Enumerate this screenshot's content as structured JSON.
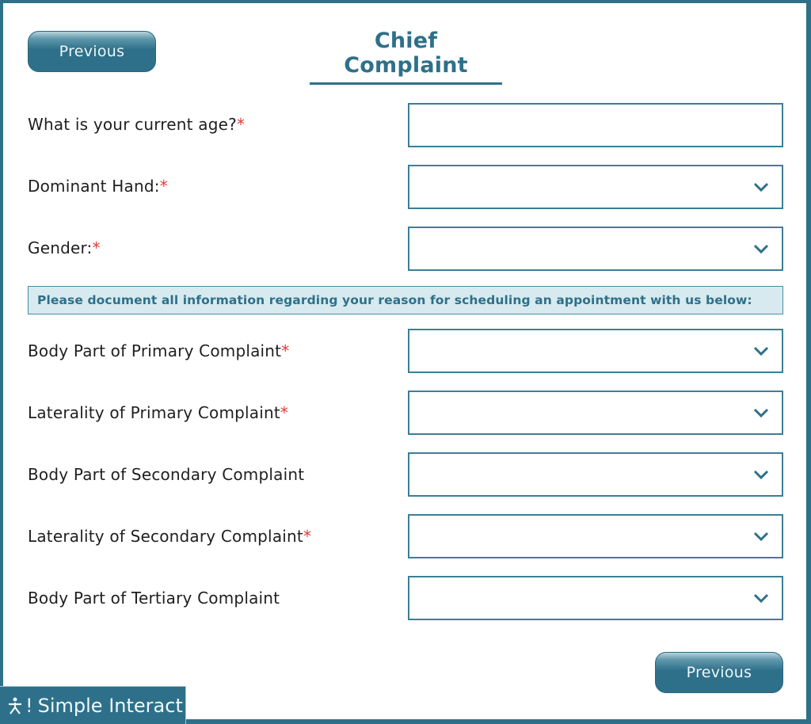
{
  "header": {
    "title": "Chief Complaint",
    "prev_top_label": "Previous"
  },
  "fields": [
    {
      "label": "What is your current age?",
      "required": "*",
      "type": "text",
      "value": "",
      "placeholder": ""
    },
    {
      "label": "Dominant Hand:",
      "required": "*",
      "type": "select",
      "value": ""
    },
    {
      "label": "Gender:",
      "required": "*",
      "type": "select",
      "value": ""
    }
  ],
  "banner": {
    "text": "Please document all information regarding your reason for scheduling an appointment with us below:"
  },
  "complaints": [
    {
      "label": "Body Part of Primary Complaint",
      "required": "*",
      "type": "select",
      "value": ""
    },
    {
      "label": "Laterality of Primary Complaint",
      "required": "*",
      "type": "select",
      "value": ""
    },
    {
      "label": "Body Part of Secondary Complaint",
      "required": "",
      "type": "select",
      "value": ""
    },
    {
      "label": "Laterality of Secondary Complaint",
      "required": "*",
      "type": "select",
      "value": ""
    },
    {
      "label": "Body Part of Tertiary Complaint",
      "required": "",
      "type": "select",
      "value": ""
    }
  ],
  "footer": {
    "prev_bottom_label": "Previous",
    "brand_mark": "!",
    "brand_name": "Simple Interact"
  },
  "icons": {
    "dropdown": "chevron-down-icon",
    "brand": "person-icon"
  },
  "colors": {
    "accent": "#2e7089",
    "required": "#e53935",
    "banner_bg": "#d7eaf0"
  }
}
